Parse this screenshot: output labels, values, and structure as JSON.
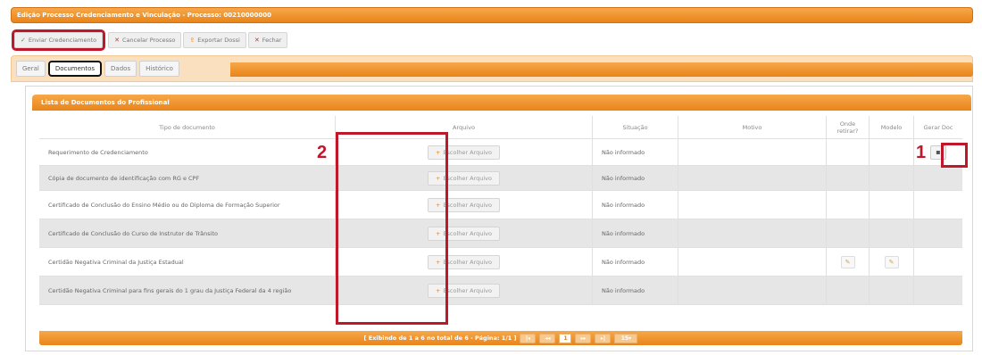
{
  "window_title": "Edição Processo Credenciamento e Vinculação - Processo: 00210000000",
  "toolbar": [
    {
      "label": "Enviar Credenciamento",
      "icon": "check-icon"
    },
    {
      "label": "Cancelar Processo",
      "icon": "close-icon"
    },
    {
      "label": "Exportar Dossi",
      "icon": "export-icon"
    },
    {
      "label": "Fechar",
      "icon": "close-icon"
    }
  ],
  "tabs": [
    "Geral",
    "Documentos",
    "Dados",
    "Histórico"
  ],
  "active_tab": "Documentos",
  "panel_title": "Lista de Documentos do Profissional",
  "columns": {
    "tipo": "Tipo de documento",
    "arquivo": "Arquivo",
    "situacao": "Situação",
    "motivo": "Motivo",
    "onde": "Onde retirar?",
    "modelo": "Modelo",
    "gerar": "Gerar Doc"
  },
  "choose_label": "Escolher Arquivo",
  "rows": [
    {
      "tipo": "Requerimento de Credenciamento",
      "situacao": "Não informado"
    },
    {
      "tipo": "Cópia de documento de identificação com RG e CPF",
      "situacao": "Não informado"
    },
    {
      "tipo": "Certificado de Conclusão do Ensino Médio ou do Diploma de Formação Superior",
      "situacao": "Não informado"
    },
    {
      "tipo": "Certificado de Conclusão do Curso de Instrutor de Trânsito",
      "situacao": "Não informado"
    },
    {
      "tipo": "Certidão Negativa Criminal da Justiça Estadual",
      "situacao": "Não informado"
    },
    {
      "tipo": "Certidão Negativa Criminal para fins gerais do 1 grau da Justiça Federal da 4 região",
      "situacao": "Não informado"
    }
  ],
  "footer": {
    "text": "[ Exibindo de 1 a 6 no total de 6 - Página: 1/1 ]",
    "current_page": "1",
    "page_size": "15"
  },
  "annotations": {
    "one": "1",
    "two": "2"
  }
}
